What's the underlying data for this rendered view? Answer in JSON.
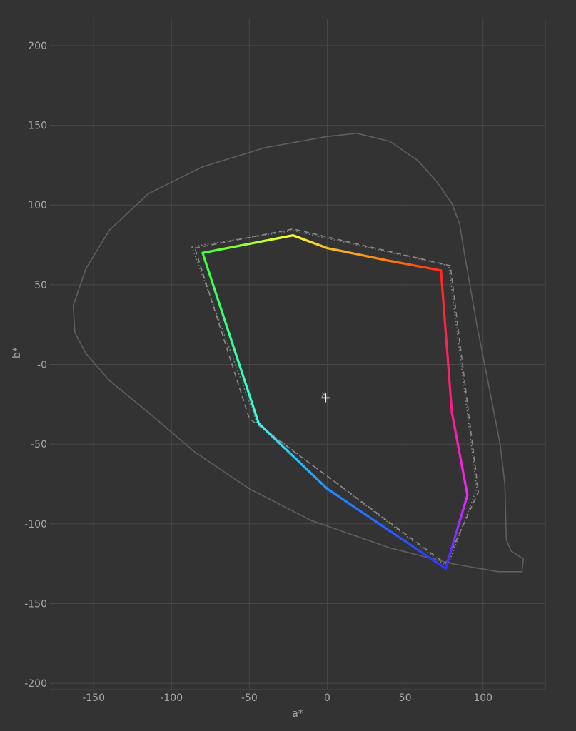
{
  "chart_data": {
    "type": "line",
    "xlabel": "a*",
    "ylabel": "b*",
    "xlim": [
      -178,
      140
    ],
    "ylim": [
      -204,
      217
    ],
    "grid": true,
    "x_ticks": [
      -150,
      -100,
      -50,
      0,
      50,
      100
    ],
    "y_ticks": [
      200,
      150,
      100,
      50,
      0,
      -50,
      -100,
      -150,
      -200
    ],
    "y_tick_labels": [
      "200",
      "150",
      "100",
      "50",
      "-0",
      "-50",
      "-100",
      "-150",
      "-200"
    ],
    "white_point": {
      "a": -1,
      "b": -21
    },
    "white_point_reference": {
      "a": -2,
      "b": -19
    },
    "series": [
      {
        "style": "spectral-locus",
        "color": "#5e5e5e",
        "points": [
          [
            19,
            145
          ],
          [
            0,
            143
          ],
          [
            -40,
            136
          ],
          [
            -80,
            124
          ],
          [
            -115,
            107
          ],
          [
            -140,
            84
          ],
          [
            -155,
            60
          ],
          [
            -163,
            37
          ],
          [
            -162,
            20
          ],
          [
            -155,
            7
          ],
          [
            -140,
            -10
          ],
          [
            -115,
            -30
          ],
          [
            -85,
            -55
          ],
          [
            -50,
            -78
          ],
          [
            -10,
            -98
          ],
          [
            40,
            -115
          ],
          [
            80,
            -125
          ],
          [
            110,
            -130
          ],
          [
            125,
            -130
          ],
          [
            126,
            -122
          ],
          [
            118,
            -117
          ],
          [
            115,
            -110
          ],
          [
            114,
            -75
          ],
          [
            111,
            -50
          ],
          [
            103,
            -10
          ],
          [
            96,
            25
          ],
          [
            88,
            70
          ],
          [
            85,
            88
          ],
          [
            80,
            101
          ],
          [
            70,
            115
          ],
          [
            58,
            128
          ],
          [
            40,
            140
          ],
          [
            19,
            145
          ]
        ]
      },
      {
        "style": "dotted-gamut",
        "color": "#8a8a8a",
        "points": [
          [
            -87,
            74
          ],
          [
            -22,
            84
          ],
          [
            78,
            62
          ],
          [
            96,
            -78
          ],
          [
            77,
            -127
          ],
          [
            -45,
            -37
          ],
          [
            -87,
            74
          ]
        ]
      },
      {
        "style": "dashed-gamut",
        "color": "#8a8a8a",
        "points": [
          [
            -85,
            73
          ],
          [
            -22,
            85
          ],
          [
            79,
            62
          ],
          [
            97,
            -80
          ],
          [
            76,
            -125
          ],
          [
            -50,
            -34
          ],
          [
            -85,
            73
          ]
        ]
      },
      {
        "style": "primary-gamut",
        "vertices": [
          {
            "a": -80,
            "b": 70,
            "color": "#39ff35"
          },
          {
            "a": -22,
            "b": 81,
            "color": "#ffff33"
          },
          {
            "a": 0,
            "b": 73,
            "color": "#f5c023"
          },
          {
            "a": 40,
            "b": 65,
            "color": "#ff7a10"
          },
          {
            "a": 73,
            "b": 59,
            "color": "#ff2a1a"
          },
          {
            "a": 80,
            "b": -30,
            "color": "#ff1a8a"
          },
          {
            "a": 90,
            "b": -82,
            "color": "#ee28ff"
          },
          {
            "a": 76,
            "b": -128,
            "color": "#3030ff"
          },
          {
            "a": 0,
            "b": -78,
            "color": "#1f8eff"
          },
          {
            "a": -44,
            "b": -37,
            "color": "#33ffee"
          },
          {
            "a": -80,
            "b": 70,
            "color": "#39ff35"
          }
        ]
      }
    ]
  }
}
